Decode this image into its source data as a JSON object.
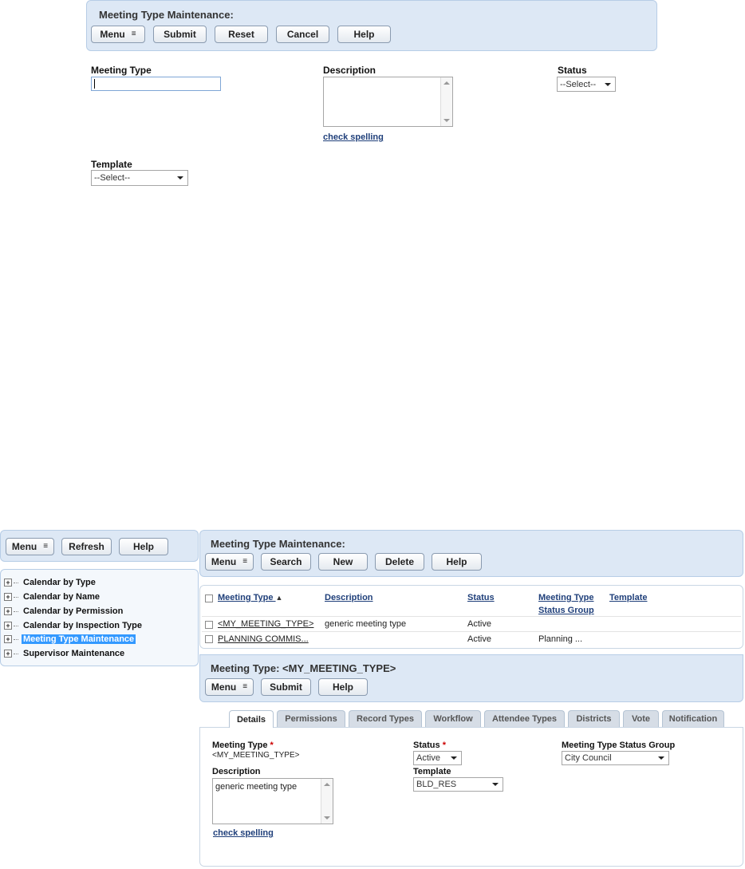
{
  "top": {
    "title": "Meeting Type Maintenance:",
    "buttons": {
      "menu": "Menu",
      "submit": "Submit",
      "reset": "Reset",
      "cancel": "Cancel",
      "help": "Help"
    },
    "fields": {
      "meeting_type_label": "Meeting Type",
      "meeting_type_value": "",
      "description_label": "Description",
      "status_label": "Status",
      "status_value": "--Select--",
      "template_label": "Template",
      "template_value": "--Select--",
      "check_spelling": "check spelling"
    }
  },
  "left_toolbar": {
    "menu": "Menu",
    "refresh": "Refresh",
    "help": "Help"
  },
  "tree": {
    "items": [
      {
        "label": "Calendar by Type",
        "selected": false
      },
      {
        "label": "Calendar by Name",
        "selected": false
      },
      {
        "label": "Calendar by Permission",
        "selected": false
      },
      {
        "label": "Calendar by Inspection Type",
        "selected": false
      },
      {
        "label": "Meeting Type Maintenance",
        "selected": true
      },
      {
        "label": "Supervisor Maintenance",
        "selected": false
      }
    ]
  },
  "list_panel": {
    "title": "Meeting Type Maintenance:",
    "buttons": {
      "menu": "Menu",
      "search": "Search",
      "new": "New",
      "delete": "Delete",
      "help": "Help"
    }
  },
  "table": {
    "headers": {
      "meeting_type": "Meeting Type",
      "description": "Description",
      "status": "Status",
      "status_group_1": "Meeting Type",
      "status_group_2": "Status Group",
      "template": "Template"
    },
    "sort_indicator": "▲",
    "rows": [
      {
        "meeting_type": "<MY_MEETING_TYPE>",
        "description": "generic meeting type",
        "status": "Active",
        "status_group": "",
        "template": ""
      },
      {
        "meeting_type": "PLANNING COMMIS...",
        "description": "",
        "status": "Active",
        "status_group": "Planning ...",
        "template": ""
      }
    ]
  },
  "detail_panel": {
    "title": "Meeting Type: <MY_MEETING_TYPE>",
    "buttons": {
      "menu": "Menu",
      "submit": "Submit",
      "help": "Help"
    }
  },
  "tabs": [
    "Details",
    "Permissions",
    "Record Types",
    "Workflow",
    "Attendee Types",
    "Districts",
    "Vote",
    "Notification"
  ],
  "details": {
    "meeting_type_label": "Meeting Type",
    "meeting_type_value": "<MY_MEETING_TYPE>",
    "required_mark": "*",
    "status_label": "Status",
    "status_value": "Active",
    "status_group_label": "Meeting Type Status Group",
    "status_group_value": "City Council",
    "description_label": "Description",
    "description_value": "generic meeting type",
    "template_label": "Template",
    "template_value": "BLD_RES",
    "check_spelling": "check spelling"
  },
  "colors": {
    "panel_bg": "#dde8f5",
    "link": "#1f3f7a",
    "selected": "#3399ff",
    "required": "#cc0000"
  }
}
